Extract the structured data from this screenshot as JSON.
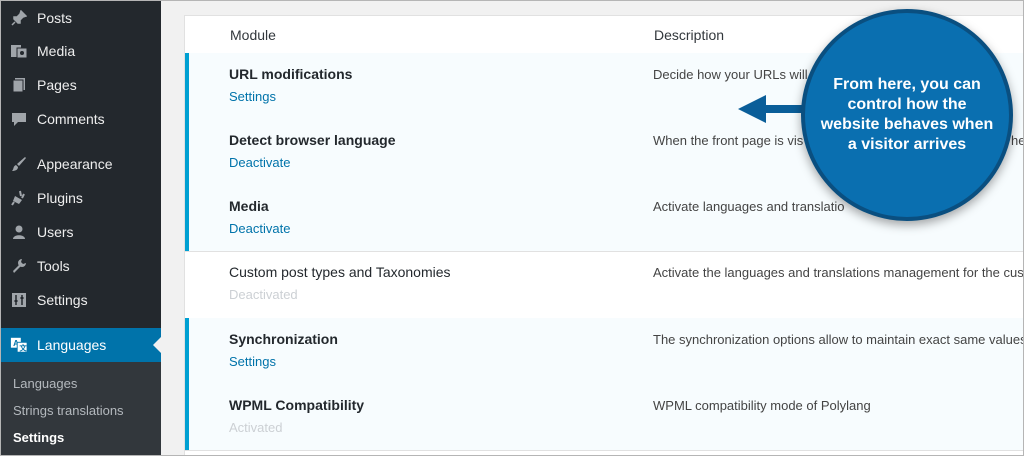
{
  "sidebar": {
    "items": [
      {
        "label": "Posts",
        "icon": "pin-icon"
      },
      {
        "label": "Media",
        "icon": "media-icon"
      },
      {
        "label": "Pages",
        "icon": "pages-icon"
      },
      {
        "label": "Comments",
        "icon": "comment-icon"
      },
      {
        "label": "Appearance",
        "icon": "paintbrush-icon"
      },
      {
        "label": "Plugins",
        "icon": "plugin-icon"
      },
      {
        "label": "Users",
        "icon": "user-icon"
      },
      {
        "label": "Tools",
        "icon": "wrench-icon"
      },
      {
        "label": "Settings",
        "icon": "settings-icon"
      },
      {
        "label": "Languages",
        "icon": "translate-icon",
        "active": true
      }
    ],
    "submenu": [
      {
        "label": "Languages"
      },
      {
        "label": "Strings translations"
      },
      {
        "label": "Settings",
        "current": true
      }
    ]
  },
  "table": {
    "headers": {
      "module": "Module",
      "description": "Description"
    },
    "rows": [
      {
        "name": "URL modifications",
        "action": "Settings",
        "description": "Decide how your URLs will l",
        "active": true
      },
      {
        "name": "Detect browser language",
        "action": "Deactivate",
        "description": "When the front page is vis",
        "description_tail": "he",
        "active": true
      },
      {
        "name": "Media",
        "action": "Deactivate",
        "description": "Activate languages and translatio",
        "active": true
      },
      {
        "name": "Custom post types and Taxonomies",
        "action": "Deactivated",
        "description": "Activate the languages and translations management for the cust",
        "active": false
      },
      {
        "name": "Synchronization",
        "action": "Settings",
        "description": "The synchronization options allow to maintain exact same values",
        "active": true
      },
      {
        "name": "WPML Compatibility",
        "action": "Activated",
        "description": "WPML compatibility mode of Polylang",
        "active": true
      }
    ]
  },
  "callout": {
    "text": "From here, you can control how the website behaves when a visitor arrives"
  },
  "colors": {
    "sidebar_bg": "#23282d",
    "submenu_bg": "#32373c",
    "active_blue": "#0073aa",
    "row_border": "#00a0d2",
    "callout_blue": "#0a6fb0"
  }
}
